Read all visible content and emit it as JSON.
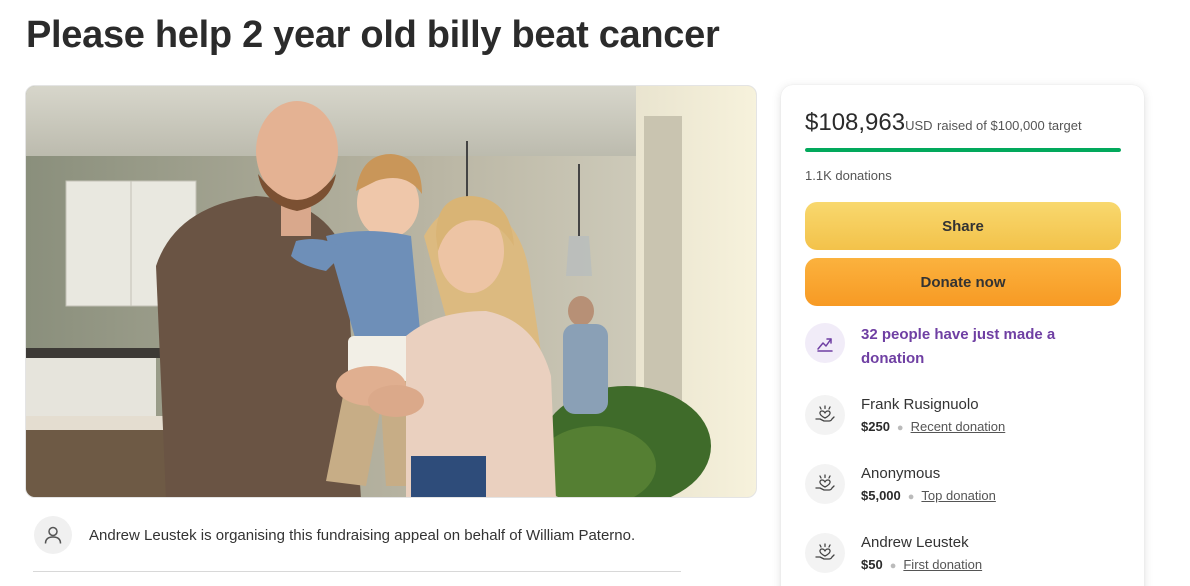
{
  "page": {
    "title": "Please help 2 year old billy beat cancer"
  },
  "organiser": {
    "text": "Andrew Leustek is organising this fundraising appeal on behalf of William Paterno."
  },
  "summary": {
    "amount_raised": "$108,963",
    "currency": "USD",
    "target_text": "raised of $100,000 target",
    "progress_fraction": 1.0,
    "donations_count": "1.1K donations"
  },
  "buttons": {
    "share": "Share",
    "donate": "Donate now"
  },
  "activity": {
    "text": "32 people have just made a donation"
  },
  "donors": [
    {
      "name": "Frank Rusignuolo",
      "amount": "$250",
      "tag": "Recent donation"
    },
    {
      "name": "Anonymous",
      "amount": "$5,000",
      "tag": "Top donation"
    },
    {
      "name": "Andrew Leustek",
      "amount": "$50",
      "tag": "First donation"
    }
  ],
  "colors": {
    "progress": "#02a95c",
    "share_button": "#f3c24a",
    "donate_button": "#f79a24",
    "activity_text": "#6f3fa3"
  },
  "icons": {
    "organiser": "person-icon",
    "activity": "trending-up-icon",
    "donor": "heart-hand-icon"
  }
}
